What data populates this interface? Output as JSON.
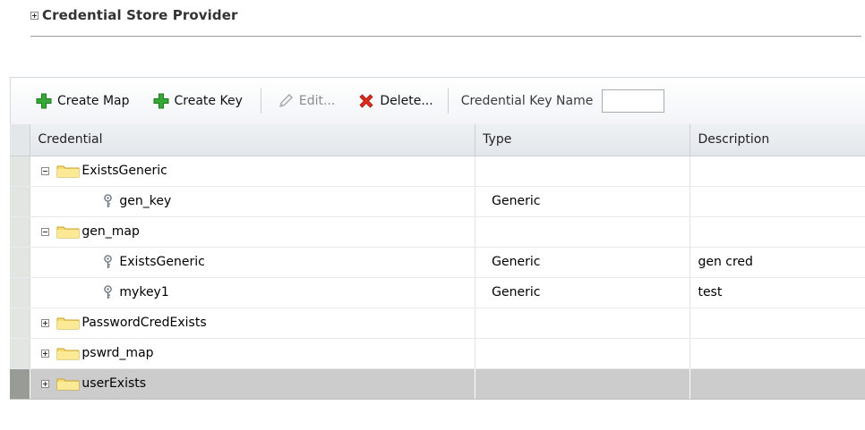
{
  "section": {
    "title": "Credential Store Provider"
  },
  "toolbar": {
    "create_map": "Create Map",
    "create_key": "Create Key",
    "edit": "Edit...",
    "delete": "Delete...",
    "key_name_label": "Credential Key Name",
    "key_name_value": ""
  },
  "table": {
    "columns": {
      "credential": "Credential",
      "type": "Type",
      "description": "Description"
    },
    "rows": [
      {
        "kind": "map",
        "expanded": true,
        "name": "ExistsGeneric",
        "type": "",
        "description": ""
      },
      {
        "kind": "key",
        "name": "gen_key",
        "type": "Generic",
        "description": ""
      },
      {
        "kind": "map",
        "expanded": true,
        "name": "gen_map",
        "type": "",
        "description": ""
      },
      {
        "kind": "key",
        "name": "ExistsGeneric",
        "type": "Generic",
        "description": "gen cred"
      },
      {
        "kind": "key",
        "name": "mykey1",
        "type": "Generic",
        "description": "test"
      },
      {
        "kind": "map",
        "expanded": false,
        "name": "PasswordCredExists",
        "type": "",
        "description": ""
      },
      {
        "kind": "map",
        "expanded": false,
        "name": "pswrd_map",
        "type": "",
        "description": ""
      },
      {
        "kind": "map",
        "expanded": false,
        "name": "userExists",
        "type": "",
        "description": "",
        "selected": true
      }
    ]
  },
  "colors": {
    "selected_row": "#cccccc",
    "header_bg": "#e8ebef",
    "folder": "#f4d96a",
    "add": "#2e9e2e",
    "delete": "#d42a1c"
  }
}
